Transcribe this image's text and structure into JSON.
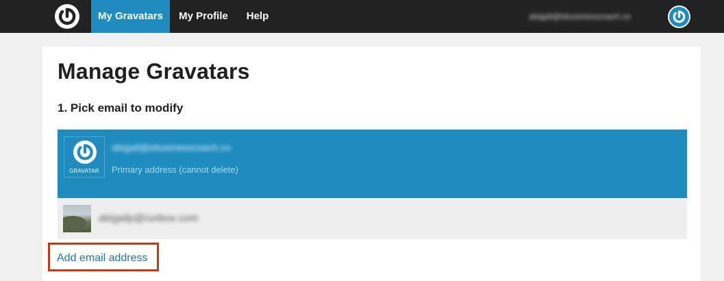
{
  "nav": {
    "items": [
      {
        "label": "My Gravatars",
        "active": true
      },
      {
        "label": "My Profile",
        "active": false
      },
      {
        "label": "Help",
        "active": false
      }
    ],
    "user_email": "abigail@ebusinesscoach.co"
  },
  "main": {
    "title": "Manage Gravatars",
    "step_heading": "1. Pick email to modify",
    "emails": [
      {
        "address": "abigail@ebusinesscoach.co",
        "note": "Primary address (cannot delete)",
        "avatar_caption": "GRAVATAR",
        "selected": true
      },
      {
        "address": "abigailp@runbox.com",
        "selected": false
      }
    ],
    "add_email_label": "Add email address"
  },
  "colors": {
    "brand": "#1e8cbe",
    "topbar": "#222222",
    "highlight_box": "#c0391b",
    "link": "#21759b"
  },
  "icons": [
    "gravatar-logo-icon"
  ]
}
